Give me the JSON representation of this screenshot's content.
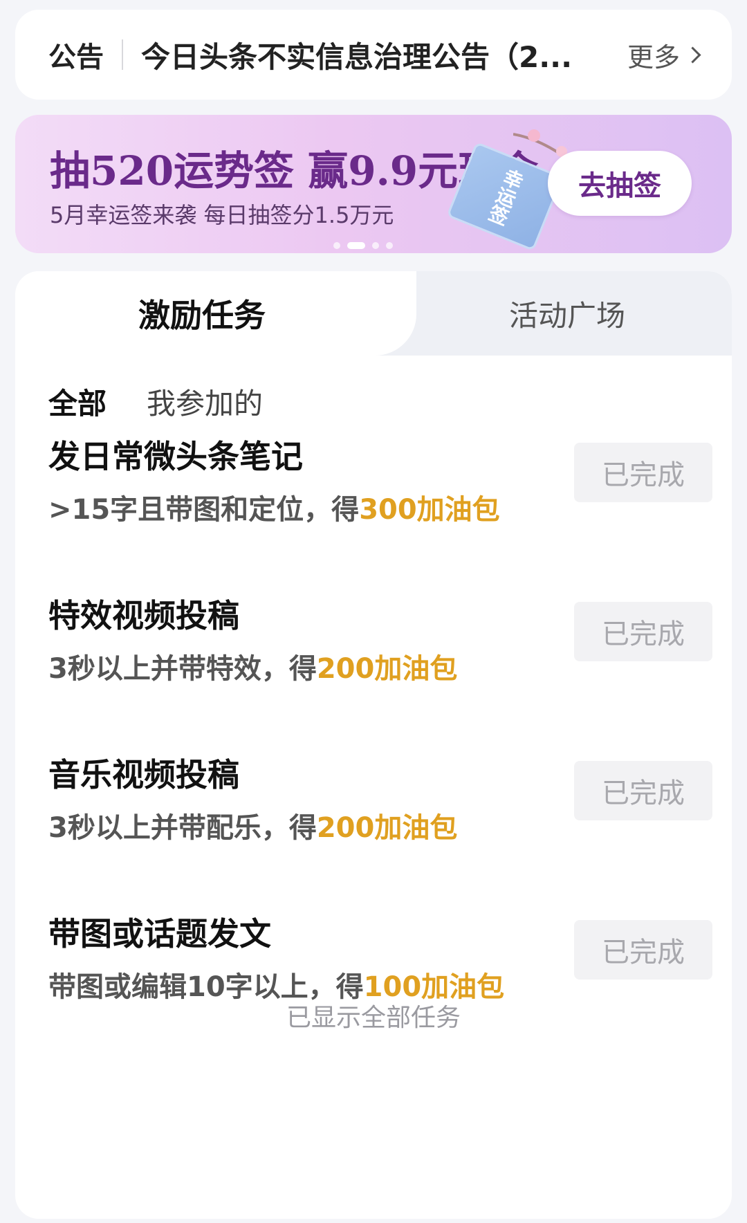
{
  "notice": {
    "label": "公告",
    "text": "今日头条不实信息治理公告（2...",
    "more": "更多"
  },
  "banner": {
    "title": "抽520运势签 赢9.9元现金",
    "subtitle": "5月幸运签来袭 每日抽签分1.5万元",
    "badge": "幸运签",
    "button": "去抽签",
    "pages": 4,
    "active_page": 2
  },
  "tabs": {
    "active": "激励任务",
    "inactive": "活动广场"
  },
  "filters": {
    "all": "全部",
    "mine": "我参加的"
  },
  "tasks": [
    {
      "title": "发日常微头条笔记",
      "desc": ">15字且带图和定位，得",
      "reward": "300加油包",
      "status": "已完成"
    },
    {
      "title": "特效视频投稿",
      "desc": "3秒以上并带特效，得",
      "reward": "200加油包",
      "status": "已完成"
    },
    {
      "title": "音乐视频投稿",
      "desc": "3秒以上并带配乐，得",
      "reward": "200加油包",
      "status": "已完成"
    },
    {
      "title": "带图或话题发文",
      "desc": "带图或编辑10字以上，得",
      "reward": "100加油包",
      "status": "已完成"
    }
  ],
  "footer": "已显示全部任务",
  "colors": {
    "reward": "#e0a020",
    "banner_text": "#6a2a8a"
  }
}
